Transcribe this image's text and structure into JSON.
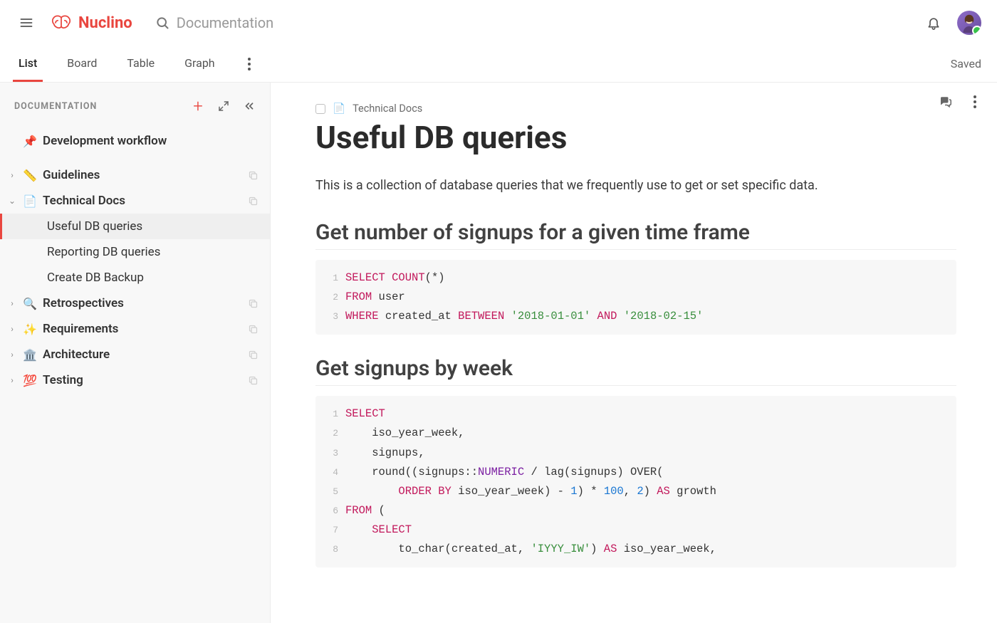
{
  "app": {
    "name": "Nuclino"
  },
  "search": {
    "placeholder": "Documentation"
  },
  "status": {
    "saved": "Saved"
  },
  "tabs": [
    {
      "label": "List",
      "active": true
    },
    {
      "label": "Board",
      "active": false
    },
    {
      "label": "Table",
      "active": false
    },
    {
      "label": "Graph",
      "active": false
    }
  ],
  "sidebar": {
    "title": "Documentation",
    "pinned": {
      "emoji": "📌",
      "label": "Development workflow"
    },
    "items": [
      {
        "emoji": "📏",
        "label": "Guidelines",
        "expanded": false,
        "bold": true
      },
      {
        "emoji": "📄",
        "label": "Technical Docs",
        "expanded": true,
        "bold": true,
        "children": [
          {
            "label": "Useful DB queries",
            "active": true
          },
          {
            "label": "Reporting DB queries",
            "active": false
          },
          {
            "label": "Create DB Backup",
            "active": false
          }
        ]
      },
      {
        "emoji": "🔍",
        "label": "Retrospectives",
        "expanded": false,
        "bold": true
      },
      {
        "emoji": "✨",
        "label": "Requirements",
        "expanded": false,
        "bold": true
      },
      {
        "emoji": "🏛️",
        "label": "Architecture",
        "expanded": false,
        "bold": true
      },
      {
        "emoji": "💯",
        "label": "Testing",
        "expanded": false,
        "bold": true
      }
    ]
  },
  "doc": {
    "breadcrumb": {
      "emoji": "📄",
      "label": "Technical Docs"
    },
    "title": "Useful DB queries",
    "intro": "This is a collection of database queries that we frequently use to get or set specific data.",
    "sections": [
      {
        "heading": "Get number of signups for a given time frame",
        "code": [
          {
            "n": 1,
            "tokens": [
              [
                "kw",
                "SELECT"
              ],
              [
                "",
                " "
              ],
              [
                "kw",
                "COUNT"
              ],
              [
                "",
                "(*)"
              ]
            ]
          },
          {
            "n": 2,
            "tokens": [
              [
                "kw",
                "FROM"
              ],
              [
                "",
                " user"
              ]
            ]
          },
          {
            "n": 3,
            "tokens": [
              [
                "kw",
                "WHERE"
              ],
              [
                "",
                " created_at "
              ],
              [
                "kw",
                "BETWEEN"
              ],
              [
                "",
                " "
              ],
              [
                "str",
                "'2018-01-01'"
              ],
              [
                "",
                " "
              ],
              [
                "kw",
                "AND"
              ],
              [
                "",
                " "
              ],
              [
                "str",
                "'2018-02-15'"
              ]
            ]
          }
        ]
      },
      {
        "heading": "Get signups by week",
        "code": [
          {
            "n": 1,
            "tokens": [
              [
                "kw",
                "SELECT"
              ]
            ]
          },
          {
            "n": 2,
            "tokens": [
              [
                "",
                "    iso_year_week,"
              ]
            ]
          },
          {
            "n": 3,
            "tokens": [
              [
                "",
                "    signups,"
              ]
            ]
          },
          {
            "n": 4,
            "tokens": [
              [
                "",
                "    round((signups::"
              ],
              [
                "typ",
                "NUMERIC"
              ],
              [
                "",
                " / lag(signups) OVER("
              ]
            ]
          },
          {
            "n": 5,
            "tokens": [
              [
                "",
                "        "
              ],
              [
                "kw",
                "ORDER BY"
              ],
              [
                "",
                " iso_year_week) - "
              ],
              [
                "num",
                "1"
              ],
              [
                "",
                ") * "
              ],
              [
                "num",
                "100"
              ],
              [
                "",
                ", "
              ],
              [
                "num",
                "2"
              ],
              [
                "",
                ") "
              ],
              [
                "kw",
                "AS"
              ],
              [
                "",
                " growth"
              ]
            ]
          },
          {
            "n": 6,
            "tokens": [
              [
                "kw",
                "FROM"
              ],
              [
                "",
                " ("
              ]
            ]
          },
          {
            "n": 7,
            "tokens": [
              [
                "",
                "    "
              ],
              [
                "kw",
                "SELECT"
              ]
            ]
          },
          {
            "n": 8,
            "tokens": [
              [
                "",
                "        to_char(created_at, "
              ],
              [
                "str",
                "'IYYY_IW'"
              ],
              [
                "",
                ") "
              ],
              [
                "kw",
                "AS"
              ],
              [
                "",
                " iso_year_week,"
              ]
            ]
          }
        ]
      }
    ]
  }
}
